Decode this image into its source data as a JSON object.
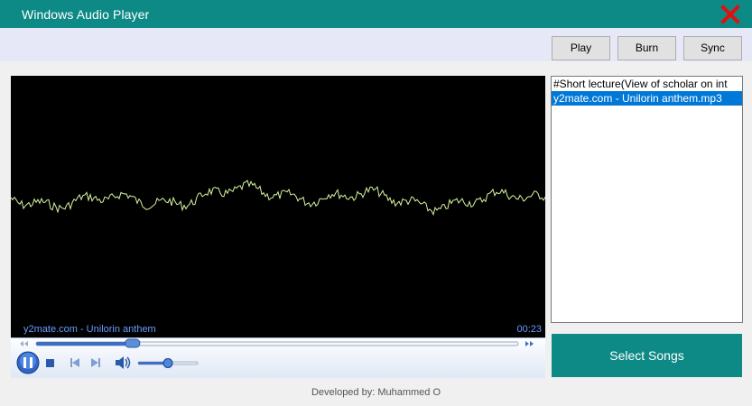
{
  "window": {
    "title": "Windows Audio Player"
  },
  "toolbar": {
    "play_label": "Play",
    "burn_label": "Burn",
    "sync_label": "Sync"
  },
  "player": {
    "now_playing": "y2mate.com - Unilorin anthem",
    "time": "00:23",
    "seek_progress": 0.2,
    "volume": 0.5
  },
  "playlist": {
    "items": [
      {
        "label": "#Short lecture(View of scholar on int"
      },
      {
        "label": "y2mate.com - Unilorin anthem.mp3"
      }
    ],
    "selected_index": 1
  },
  "select_songs_label": "Select Songs",
  "footer": {
    "credit": "Developed by: Muhammed O"
  },
  "colors": {
    "accent": "#0e8a86",
    "wave": "#d8f5a0",
    "selection": "#0078d7"
  }
}
